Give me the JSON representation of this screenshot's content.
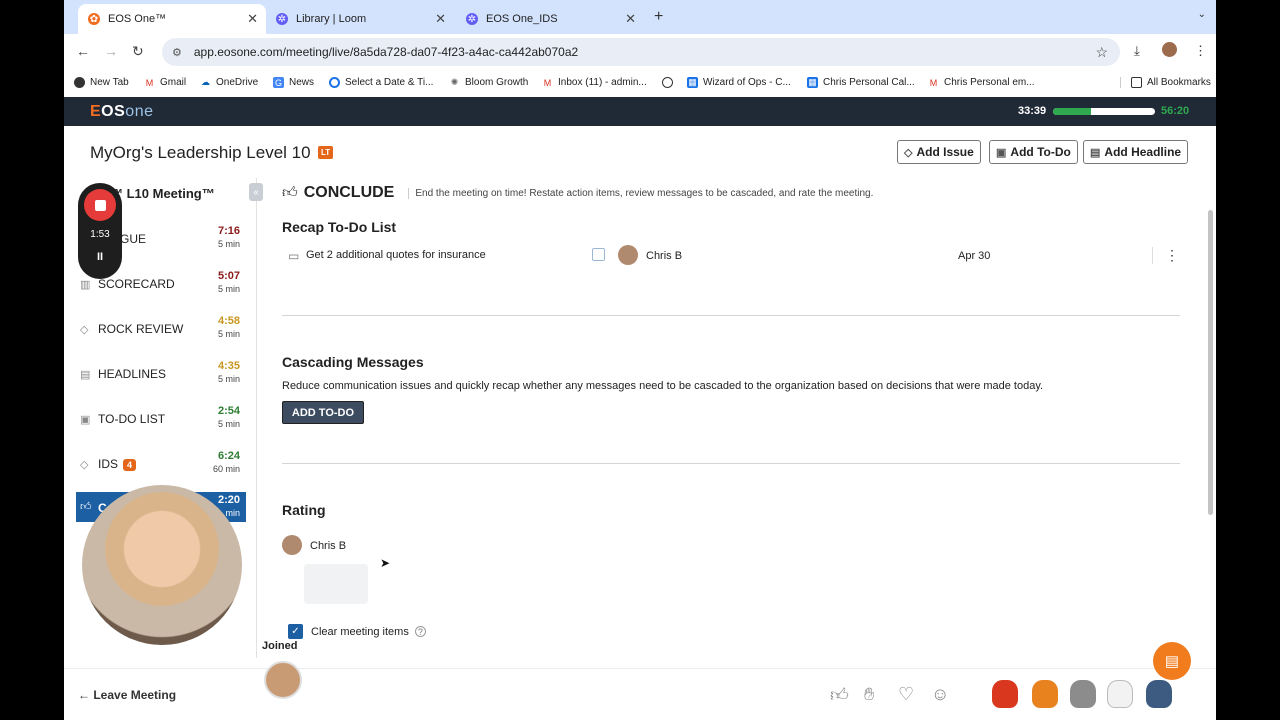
{
  "browser": {
    "tabs": [
      {
        "title": "EOS One™",
        "active": true
      },
      {
        "title": "Library | Loom",
        "active": false
      },
      {
        "title": "EOS One_IDS",
        "active": false
      }
    ],
    "url": "app.eosone.com/meeting/live/8a5da728-da07-4f23-a4ac-ca442ab070a2",
    "bookmarks": [
      "New Tab",
      "Gmail",
      "OneDrive",
      "News",
      "Select a Date & Ti...",
      "Bloom Growth",
      "Inbox (11) - admin...",
      "",
      "Wizard of Ops - C...",
      "Chris Personal Cal...",
      "Chris Personal em..."
    ],
    "all_bookmarks": "All Bookmarks"
  },
  "app": {
    "logo_e": "E",
    "logo_os": "OS",
    "logo_one": "one",
    "elapsed": "33:39",
    "remaining": "56:20",
    "progress": 0.37
  },
  "meeting": {
    "title": "MyOrg's Leadership Level 10",
    "badge": "LT",
    "actions": [
      "Add Issue",
      "Add To-Do",
      "Add Headline"
    ]
  },
  "sidebar": {
    "title": "™ L10 Meeting™",
    "items": [
      {
        "label": "GUE",
        "time": "7:16",
        "dur": "5 min",
        "color": "#8b1a1a"
      },
      {
        "label": "SCORECARD",
        "time": "5:07",
        "dur": "5 min",
        "color": "#8b1a1a"
      },
      {
        "label": "ROCK REVIEW",
        "time": "4:58",
        "dur": "5 min",
        "color": "#c8961e"
      },
      {
        "label": "HEADLINES",
        "time": "4:35",
        "dur": "5 min",
        "color": "#c8961e"
      },
      {
        "label": "TO-DO LIST",
        "time": "2:54",
        "dur": "5 min",
        "color": "#2e7d32"
      },
      {
        "label": "IDS",
        "badge": "4",
        "time": "6:24",
        "dur": "60 min",
        "color": "#2e7d32"
      },
      {
        "label": "C",
        "time": "2:20",
        "dur": "min",
        "color": "#fff"
      }
    ]
  },
  "loom": {
    "time": "1:53",
    "pause": "II"
  },
  "conclude": {
    "title": "CONCLUDE",
    "description": "End the meeting on time! Restate action items, review messages to be cascaded, and rate the meeting.",
    "recap_title": "Recap To-Do List",
    "todo": {
      "text": "Get 2 additional quotes for insurance",
      "owner": "Chris B",
      "due": "Apr 30"
    },
    "cascade_title": "Cascading Messages",
    "cascade_text": "Reduce communication issues and quickly recap whether any messages need to be cascaded to the organization based on decisions that were made today.",
    "add_todo": "ADD TO-DO",
    "rating_title": "Rating",
    "rater": "Chris B",
    "clear_label": "Clear meeting items"
  },
  "footer": {
    "joined": "Joined",
    "leave": "Leave Meeting"
  },
  "icons": {
    "accent": "#f26d21",
    "primary": "#1d5fa3"
  }
}
